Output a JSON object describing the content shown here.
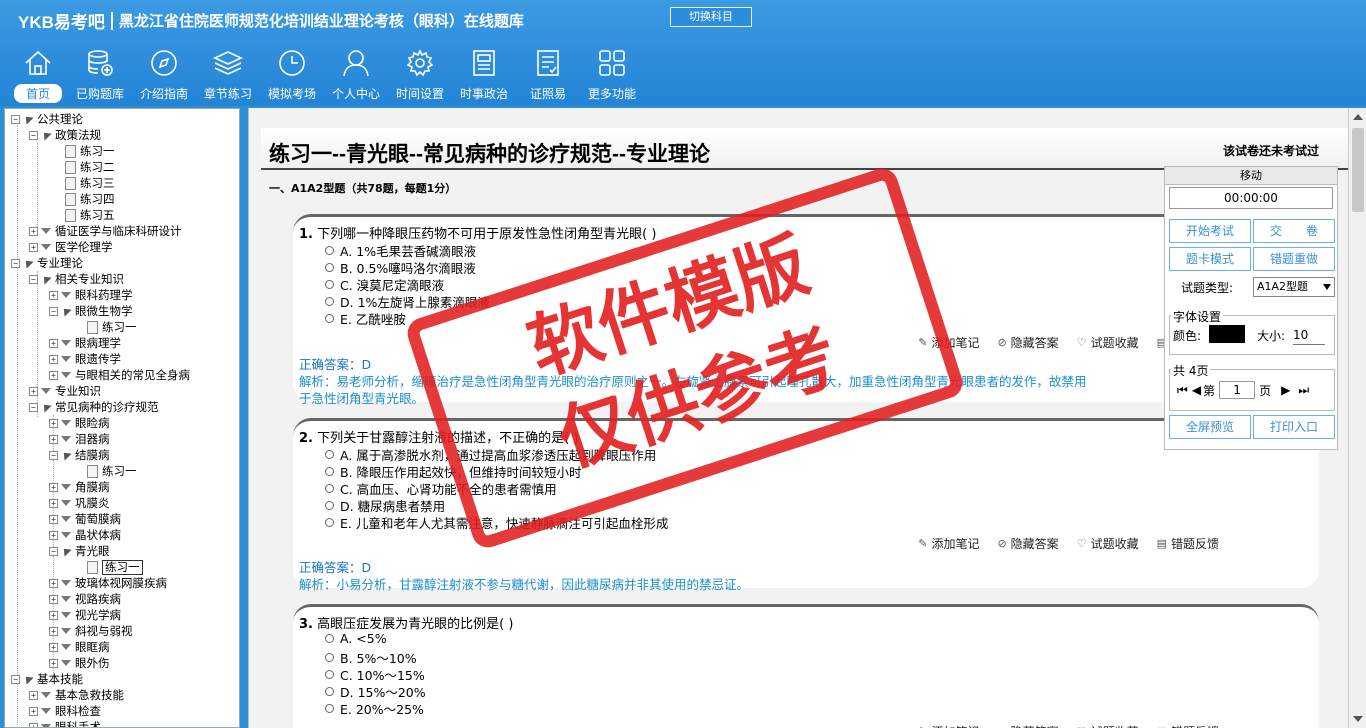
{
  "header": {
    "logo": "YKB易考吧",
    "title": "黑龙江省住院医师规范化培训结业理论考核（眼科）在线题库",
    "switch_label": "切换科目"
  },
  "nav": [
    {
      "label": "首页",
      "icon": "home-icon"
    },
    {
      "label": "已购题库",
      "icon": "database-icon"
    },
    {
      "label": "介绍指南",
      "icon": "compass-icon"
    },
    {
      "label": "章节练习",
      "icon": "layers-icon"
    },
    {
      "label": "模拟考场",
      "icon": "clock-icon"
    },
    {
      "label": "个人中心",
      "icon": "user-icon"
    },
    {
      "label": "时间设置",
      "icon": "gear-icon"
    },
    {
      "label": "时事政治",
      "icon": "news-icon"
    },
    {
      "label": "证照易",
      "icon": "checklist-icon"
    },
    {
      "label": "更多功能",
      "icon": "grid-icon"
    }
  ],
  "tree": [
    "公共理论",
    "政策法规",
    "练习一",
    "练习二",
    "练习三",
    "练习四",
    "练习五",
    "循证医学与临床科研设计",
    "医学伦理学",
    "专业理论",
    "相关专业知识",
    "眼科药理学",
    "眼微生物学",
    "练习一",
    "眼病理学",
    "眼遗传学",
    "与眼相关的常见全身病",
    "专业知识",
    "常见病种的诊疗规范",
    "眼睑病",
    "泪器病",
    "结膜病",
    "练习一",
    "角膜病",
    "巩膜炎",
    "葡萄膜病",
    "晶状体病",
    "青光眼",
    "练习一",
    "玻璃体视网膜疾病",
    "视路疾病",
    "视光学病",
    "斜视与弱视",
    "眼眶病",
    "眼外伤",
    "基本技能",
    "基本急救技能",
    "眼科检查",
    "眼科手术"
  ],
  "exam": {
    "title": "练习一--青光眼--常见病种的诊疗规范--专业理论",
    "status": "该试卷还未考试过",
    "section": "一、A1A2型题（共78题，每题1分）"
  },
  "actions": {
    "note": "添加笔记",
    "hide": "隐藏答案",
    "fav": "试题收藏",
    "feedback": "错题反馈"
  },
  "questions": [
    {
      "stem": "下列哪一种降眼压药物不可用于原发性急性闭角型青光眼( )",
      "num": "1.",
      "options": [
        "A. 1%毛果芸香碱滴眼液",
        "B. 0.5%噻吗洛尔滴眼液",
        "C. 溴莫尼定滴眼液",
        "D. 1%左旋肾上腺素滴眼液",
        "E. 乙酰唑胺"
      ],
      "answer": "正确答案：D",
      "analysis_1": "解析：易老师分析，缩瞳治疗是急性闭角型青光眼的治疗原则之一。左旋肾上腺素可引起瞳孔散大，加重急性闭角型青光眼患者的发作，故禁用",
      "analysis_2": "于急性闭角型青光眼。"
    },
    {
      "stem": "下列关于甘露醇注射液的描述，不正确的是( )",
      "num": "2.",
      "options": [
        "A. 属于高渗脱水剂，通过提高血浆渗透压起到降眼压作用",
        "B. 降眼压作用起效快，但维持时间较短小时",
        "C. 高血压、心肾功能不全的患者需慎用",
        "D. 糖尿病患者禁用",
        "E. 儿童和老年人尤其需注意，快速静脉滴注可引起血栓形成"
      ],
      "answer": "正确答案：D",
      "analysis_1": "解析：小易分析，甘露醇注射液不参与糖代谢，因此糖尿病并非其使用的禁忌证。"
    },
    {
      "stem": "高眼压症发展为青光眼的比例是( )",
      "num": "3.",
      "options": [
        "A. <5%",
        "B. 5%～10%",
        "C. 10%～15%",
        "D. 15%～20%",
        "E. 20%～25%"
      ]
    }
  ],
  "panel": {
    "move": "移动",
    "timer": "00:00:00",
    "start": "开始考试",
    "submit": "交　　卷",
    "card_mode": "题卡模式",
    "redo": "错题重做",
    "type_label": "试题类型:",
    "type_value": "A1A2型题",
    "font_group": "字体设置",
    "color_label": "颜色:",
    "size_label": "大小:",
    "size_value": "10",
    "pages": "共 4页",
    "page_prefix": "第",
    "page_value": "1",
    "page_suffix": "页",
    "fullscreen": "全屏预览",
    "print": "打印入口"
  },
  "watermark": {
    "line1": "软件模版",
    "line2": "仅供参考"
  },
  "colors": {
    "header": "#2f8fd9",
    "accent": "#3a8fd6",
    "stamp": "#e21e1e",
    "answer": "#1a73c8"
  }
}
